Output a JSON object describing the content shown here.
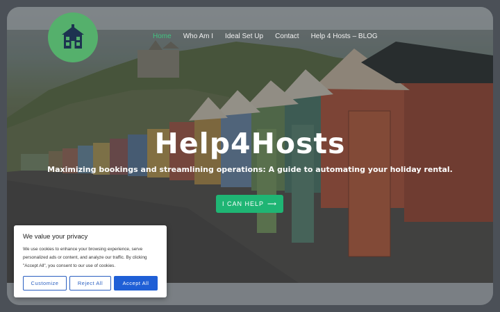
{
  "nav": {
    "items": [
      {
        "label": "Home",
        "active": true
      },
      {
        "label": "Who Am I",
        "active": false
      },
      {
        "label": "Ideal Set Up",
        "active": false
      },
      {
        "label": "Contact",
        "active": false
      },
      {
        "label": "Help 4 Hosts – BLOG",
        "active": false
      }
    ]
  },
  "logo": {
    "icon": "house-icon"
  },
  "hero": {
    "title": "Help4Hosts",
    "subtitle": "Maximizing bookings and streamlining operations: A guide to automating your holiday rental.",
    "cta_label": "I CAN HELP",
    "cta_icon": "arrow-right-icon"
  },
  "cookie": {
    "title": "We value your privacy",
    "text": "We use cookies to enhance your browsing experience, serve personalized ads or content, and analyze our traffic. By clicking \"Accept All\", you consent to our use of cookies.",
    "customize_label": "Customize",
    "reject_label": "Reject All",
    "accept_label": "Accept All"
  },
  "colors": {
    "accent": "#1fb574",
    "nav_active": "#42c281",
    "logo_bg": "#55b06c",
    "cookie_button": "#1f5fd6"
  }
}
